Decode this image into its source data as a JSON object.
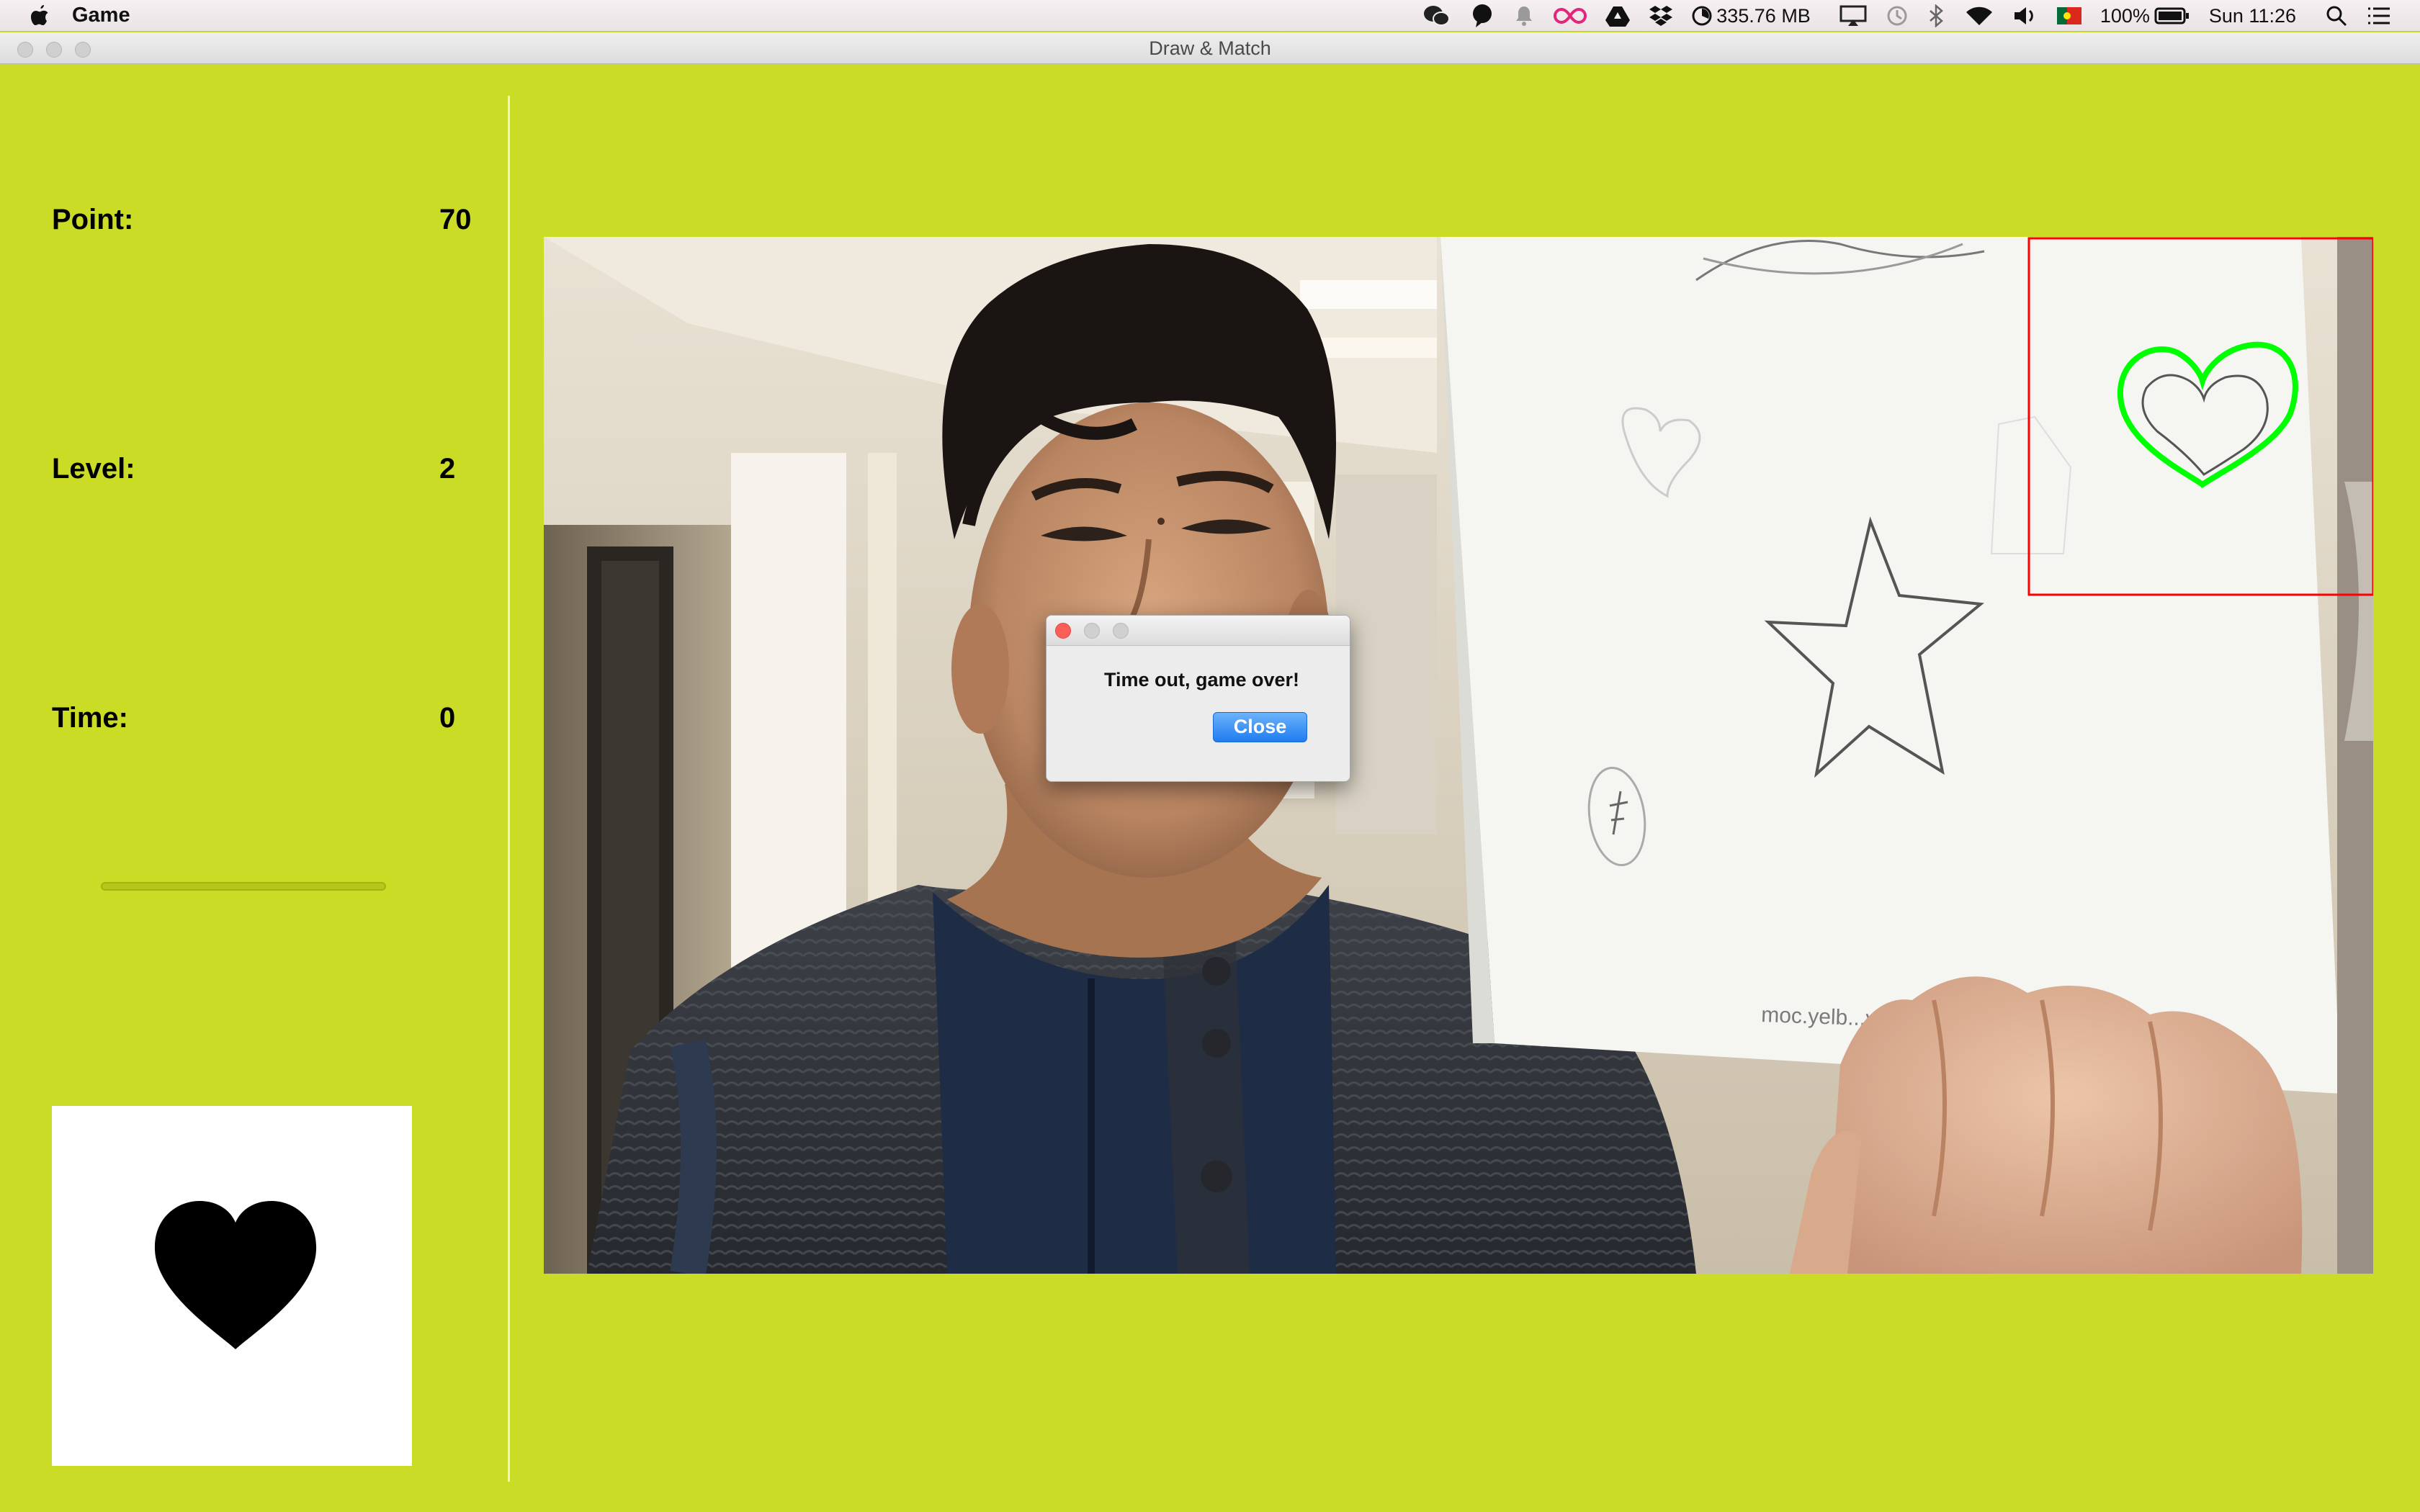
{
  "menubar": {
    "app_name": "Game",
    "memory": "335.76 MB",
    "battery": "100%",
    "clock": "Sun 11:26",
    "icons": [
      "apple-icon",
      "wechat-icon",
      "chat-bubble-icon",
      "notification-icon",
      "infinity-icon",
      "google-drive-icon",
      "dropbox-icon",
      "memory-gauge-icon",
      "airplay-icon",
      "time-machine-icon",
      "bluetooth-icon",
      "wifi-icon",
      "volume-icon",
      "portugal-flag-icon",
      "battery-icon",
      "spotlight-icon",
      "notification-center-icon"
    ]
  },
  "window": {
    "title": "Draw & Match"
  },
  "stats": {
    "point_label": "Point:",
    "point_value": "70",
    "level_label": "Level:",
    "level_value": "2",
    "time_label": "Time:",
    "time_value": "0",
    "time_progress": 0
  },
  "target": {
    "shape": "heart",
    "color": "#000000"
  },
  "camera": {
    "detected_shape": "heart",
    "detection_color": "#00ff00",
    "roi_color": "#ff0000",
    "paper_text": "moc.yelb...ywn"
  },
  "dialog": {
    "message": "Time out, game over!",
    "close_label": "Close"
  },
  "colors": {
    "background": "#cbdc27",
    "button_blue": "#1f7cf1"
  }
}
